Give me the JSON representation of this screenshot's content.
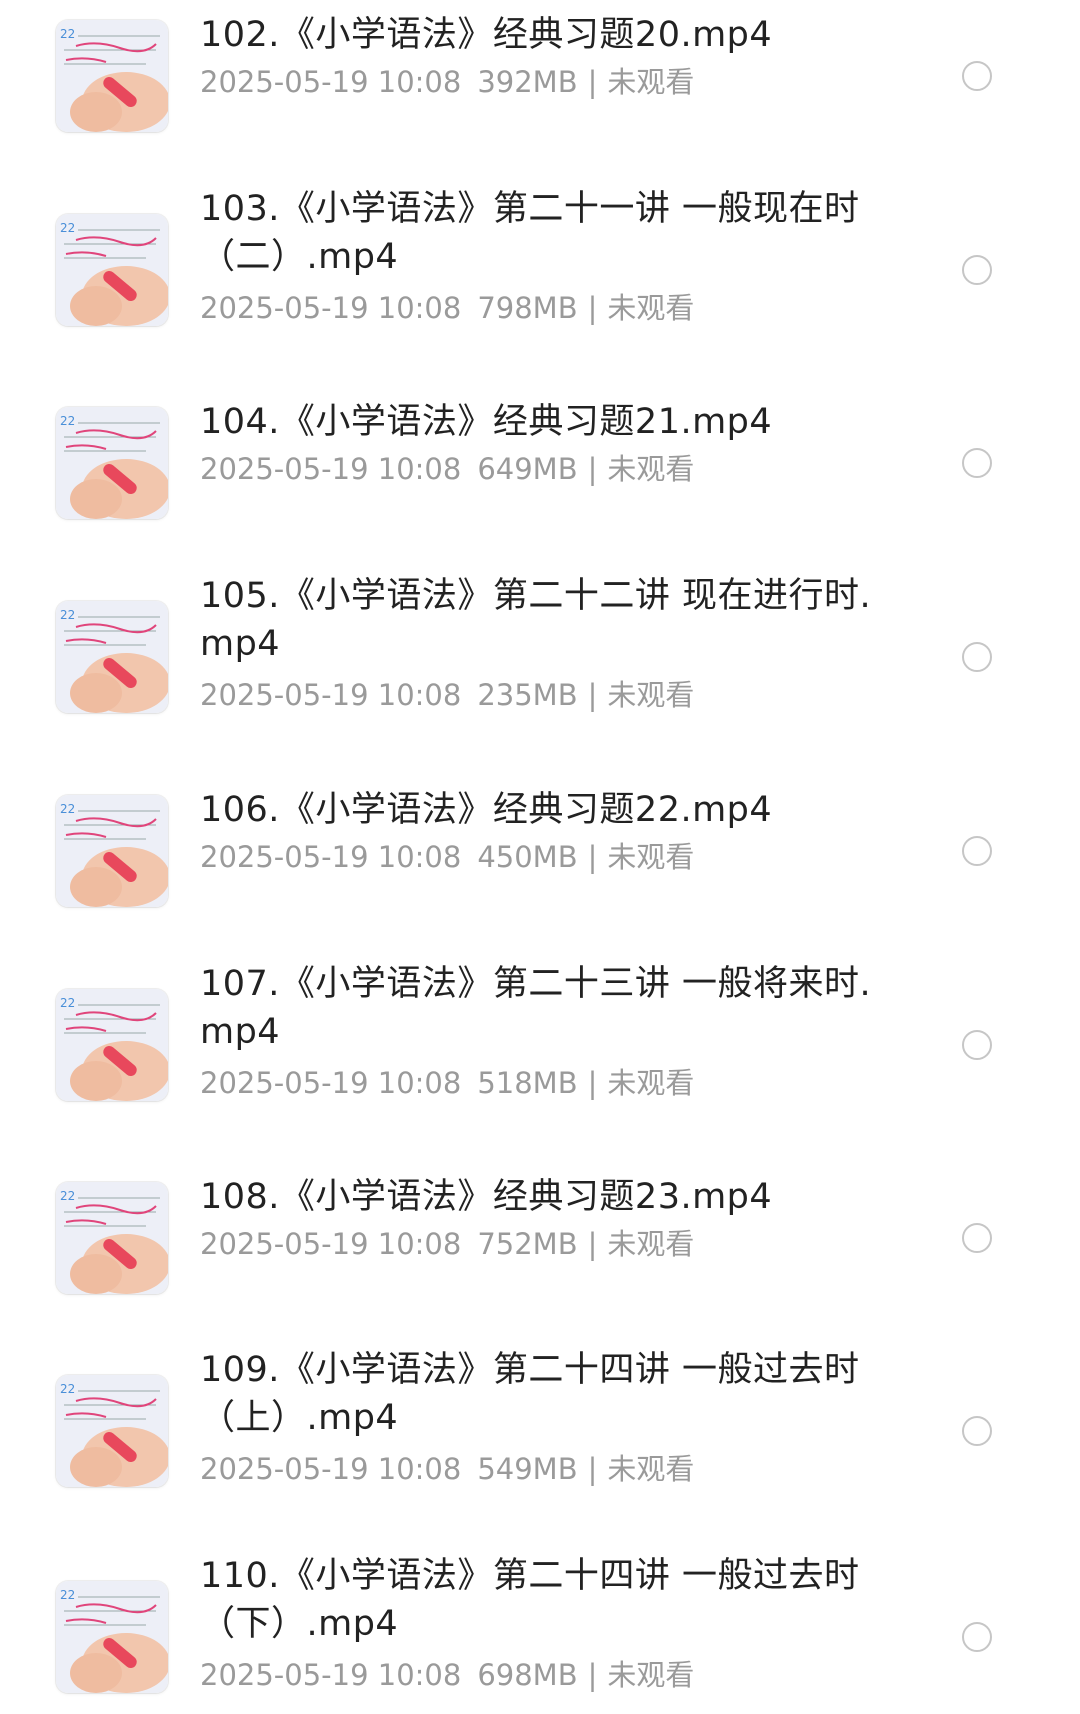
{
  "files": [
    {
      "title": "102.《小学语法》经典习题20.mp4",
      "date": "2025-05-19 10:08",
      "size": "392MB",
      "status": "未观看",
      "lines": 1
    },
    {
      "title": "103.《小学语法》第二十一讲 一般现在时（二）.mp4",
      "date": "2025-05-19 10:08",
      "size": "798MB",
      "status": "未观看",
      "lines": 2
    },
    {
      "title": "104.《小学语法》经典习题21.mp4",
      "date": "2025-05-19 10:08",
      "size": "649MB",
      "status": "未观看",
      "lines": 1
    },
    {
      "title": "105.《小学语法》第二十二讲 现在进行时.mp4",
      "date": "2025-05-19 10:08",
      "size": "235MB",
      "status": "未观看",
      "lines": 2
    },
    {
      "title": "106.《小学语法》经典习题22.mp4",
      "date": "2025-05-19 10:08",
      "size": "450MB",
      "status": "未观看",
      "lines": 1
    },
    {
      "title": "107.《小学语法》第二十三讲 一般将来时.mp4",
      "date": "2025-05-19 10:08",
      "size": "518MB",
      "status": "未观看",
      "lines": 2
    },
    {
      "title": "108.《小学语法》经典习题23.mp4",
      "date": "2025-05-19 10:08",
      "size": "752MB",
      "status": "未观看",
      "lines": 1
    },
    {
      "title": "109.《小学语法》第二十四讲 一般过去时（上）.mp4",
      "date": "2025-05-19 10:08",
      "size": "549MB",
      "status": "未观看",
      "lines": 2
    },
    {
      "title": "110.《小学语法》第二十四讲 一般过去时（下）.mp4",
      "date": "2025-05-19 10:08",
      "size": "698MB",
      "status": "未观看",
      "lines": 2
    }
  ],
  "colors": {
    "title": "#222222",
    "meta": "#9a9a9a",
    "checkbox_border": "#c6c6c6",
    "thumbnail_ink": "#e0457b"
  },
  "icons": {
    "select": "circle-outline-icon",
    "thumbnail": "video-thumbnail-icon"
  }
}
